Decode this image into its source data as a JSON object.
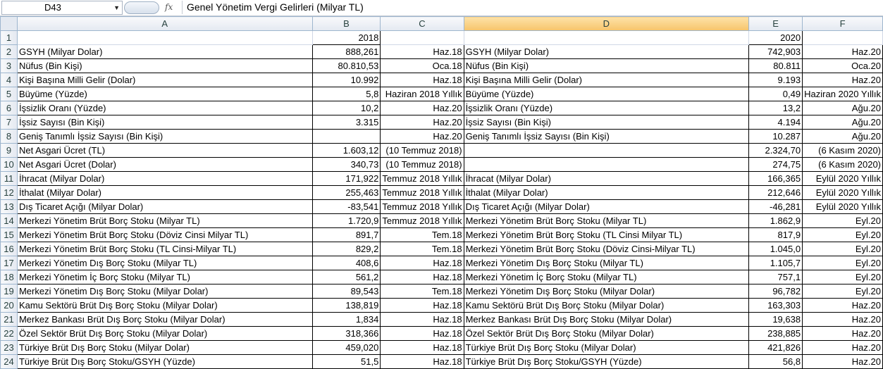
{
  "name_box": "D43",
  "formula": "Genel Yönetim Vergi Gelirleri (Milyar TL)",
  "columns": [
    "A",
    "B",
    "C",
    "D",
    "E",
    "F"
  ],
  "rows": [
    [
      "",
      "2018",
      "",
      "",
      "2020",
      ""
    ],
    [
      "GSYH (Milyar Dolar)",
      "888,261",
      "Haz.18",
      "GSYH (Milyar Dolar)",
      "742,903",
      "Haz.20"
    ],
    [
      "Nüfus (Bin Kişi)",
      "80.810,53",
      "Oca.18",
      "Nüfus (Bin Kişi)",
      "80.811",
      "Oca.20"
    ],
    [
      "Kişi Başına Milli Gelir (Dolar)",
      "10.992",
      "Haz.18",
      "Kişi Başına Milli Gelir (Dolar)",
      "9.193",
      "Haz.20"
    ],
    [
      "Büyüme (Yüzde)",
      "5,8",
      "Haziran 2018 Yıllık",
      "Büyüme (Yüzde)",
      "0,49",
      "Haziran 2020 Yıllık"
    ],
    [
      "İşsizlik Oranı (Yüzde)",
      "10,2",
      "Haz.20",
      "İşsizlik Oranı (Yüzde)",
      "13,2",
      "Ağu.20"
    ],
    [
      "İşsiz Sayısı (Bin Kişi)",
      "3.315",
      "Haz.20",
      "İşsiz Sayısı (Bin Kişi)",
      "4.194",
      "Ağu.20"
    ],
    [
      "Geniş Tanımlı İşsiz Sayısı (Bin Kişi)",
      "",
      "Haz.20",
      "Geniş Tanımlı İşsiz Sayısı (Bin Kişi)",
      "10.287",
      "Ağu.20"
    ],
    [
      "Net Asgari Ücret (TL)",
      "1.603,12",
      "(10 Temmuz 2018)",
      "",
      "2.324,70",
      "(6 Kasım 2020)"
    ],
    [
      "Net Asgari Ücret (Dolar)",
      "340,73",
      "(10 Temmuz 2018)",
      "",
      "274,75",
      "(6 Kasım 2020)"
    ],
    [
      "İhracat (Milyar Dolar)",
      "171,922",
      "Temmuz 2018 Yıllık",
      "İhracat (Milyar Dolar)",
      "166,365",
      "Eylül 2020 Yıllık"
    ],
    [
      "İthalat (Milyar Dolar)",
      "255,463",
      "Temmuz 2018 Yıllık",
      "İthalat (Milyar Dolar)",
      "212,646",
      "Eylül 2020 Yıllık"
    ],
    [
      "Dış Ticaret Açığı (Milyar Dolar)",
      "-83,541",
      "Temmuz 2018 Yıllık",
      "Dış Ticaret Açığı (Milyar Dolar)",
      "-46,281",
      "Eylül 2020 Yıllık"
    ],
    [
      "Merkezi Yönetim Brüt Borç Stoku (Milyar TL)",
      "1.720,9",
      "Temmuz 2018 Yıllık",
      "Merkezi Yönetim Brüt Borç Stoku (Milyar TL)",
      "1.862,9",
      "Eyl.20"
    ],
    [
      "Merkezi Yönetim Brüt Borç Stoku (Döviz Cinsi Milyar TL)",
      "891,7",
      "Tem.18",
      "Merkezi Yönetim Brüt Borç Stoku (TL Cinsi Milyar TL)",
      "817,9",
      "Eyl.20"
    ],
    [
      "Merkezi Yönetim Brüt Borç Stoku (TL Cinsi-Milyar TL)",
      "829,2",
      "Tem.18",
      "Merkezi Yönetim Brüt Borç Stoku (Döviz Cinsi-Milyar TL)",
      "1.045,0",
      "Eyl.20"
    ],
    [
      "Merkezi Yönetim Dış Borç Stoku (Milyar TL)",
      "408,6",
      "Haz.18",
      "Merkezi Yönetim Dış Borç Stoku (Milyar TL)",
      "1.105,7",
      "Eyl.20"
    ],
    [
      "Merkezi Yönetim İç Borç Stoku (Milyar TL)",
      "561,2",
      "Haz.18",
      "Merkezi Yönetim İç Borç Stoku (Milyar TL)",
      "757,1",
      "Eyl.20"
    ],
    [
      "Merkezi Yönetim Dış Borç Stoku (Milyar Dolar)",
      "89,543",
      "Tem.18",
      "Merkezi Yönetim Dış Borç Stoku (Milyar Dolar)",
      "96,782",
      "Eyl.20"
    ],
    [
      "Kamu Sektörü Brüt Dış Borç Stoku (Milyar Dolar)",
      "138,819",
      "Haz.18",
      "Kamu Sektörü Brüt Dış Borç Stoku (Milyar Dolar)",
      "163,303",
      "Haz.20"
    ],
    [
      "Merkez Bankası Brüt Dış Borç Stoku (Milyar Dolar)",
      "1,834",
      "Haz.18",
      "Merkez Bankası Brüt Dış Borç Stoku (Milyar Dolar)",
      "19,638",
      "Haz.20"
    ],
    [
      "Özel Sektör Brüt Dış Borç Stoku (Milyar Dolar)",
      "318,366",
      "Haz.18",
      "Özel Sektör Brüt Dış Borç Stoku (Milyar Dolar)",
      "238,885",
      "Haz.20"
    ],
    [
      "Türkiye Brüt Dış Borç Stoku (Milyar Dolar)",
      "459,020",
      "Haz.18",
      "Türkiye Brüt Dış Borç Stoku (Milyar Dolar)",
      "421,826",
      "Haz.20"
    ],
    [
      "Türkiye Brüt Dış Borç Stoku/GSYH (Yüzde)",
      "51,5",
      "Haz.18",
      "Türkiye Brüt Dış Borç Stoku/GSYH (Yüzde)",
      "56,8",
      "Haz.20"
    ]
  ]
}
